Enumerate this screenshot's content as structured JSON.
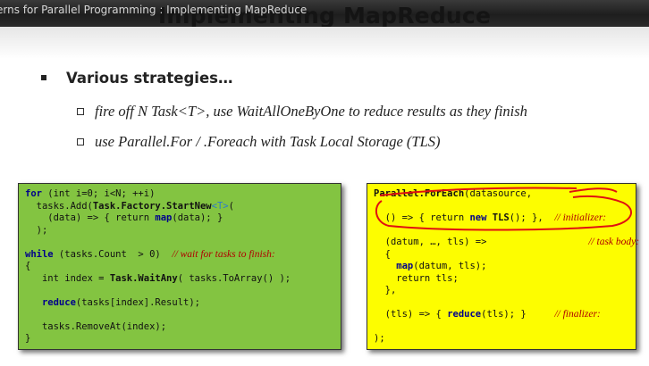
{
  "window": {
    "title": "erns for Parallel Programming : Implementing MapReduce"
  },
  "slide": {
    "title": "Implementing MapReduce",
    "bullet_main": "Various strategies…",
    "sub_bullets": [
      "fire off N Task<T>, use WaitAllOneByOne to reduce results as they finish",
      "use Parallel.For / .Foreach with Task Local Storage (TLS)"
    ]
  },
  "code_left": {
    "l1_kw": "for",
    "l1_rest": " (int i=0; i<N; ++i)",
    "l2a": "  tasks.Add(",
    "l2_b": "Task.Factory.StartNew",
    "l2_ty": "<T>",
    "l2c": "(",
    "l3a": "    (data) => { return ",
    "l3_fn": "map",
    "l3b": "(data); }",
    "l4": "  );",
    "l5_kw": "while",
    "l5_rest": " (tasks.Count  > 0)  ",
    "l5_cm": "// wait for tasks to finish:",
    "l6": "{",
    "l7a": "   int index = ",
    "l7_b": "Task.WaitAny",
    "l7b": "( tasks.ToArray() );",
    "l8_fn": "   reduce",
    "l8b": "(tasks[index].Result);",
    "l9": "   tasks.RemoveAt(index);",
    "l10": "}"
  },
  "code_right": {
    "l1_b": "Parallel.ForEach",
    "l1b": "(datasource,",
    "l2a": "  () => { return ",
    "l2_kw": "new",
    "l2_b": " TLS",
    "l2b": "(); },  ",
    "l2_cm": "// initializer:",
    "l3a": "  (datum, …, tls) =>",
    "l3_cm": "// task body:",
    "l4": "  {",
    "l5_fn": "    map",
    "l5b": "(datum, tls);",
    "l6": "    return tls;",
    "l7": "  },",
    "l8a": "  (tls) => { ",
    "l8_fn": "reduce",
    "l8b": "(tls); }",
    "l8_cm": "// finalizer:",
    "l9": ");"
  }
}
